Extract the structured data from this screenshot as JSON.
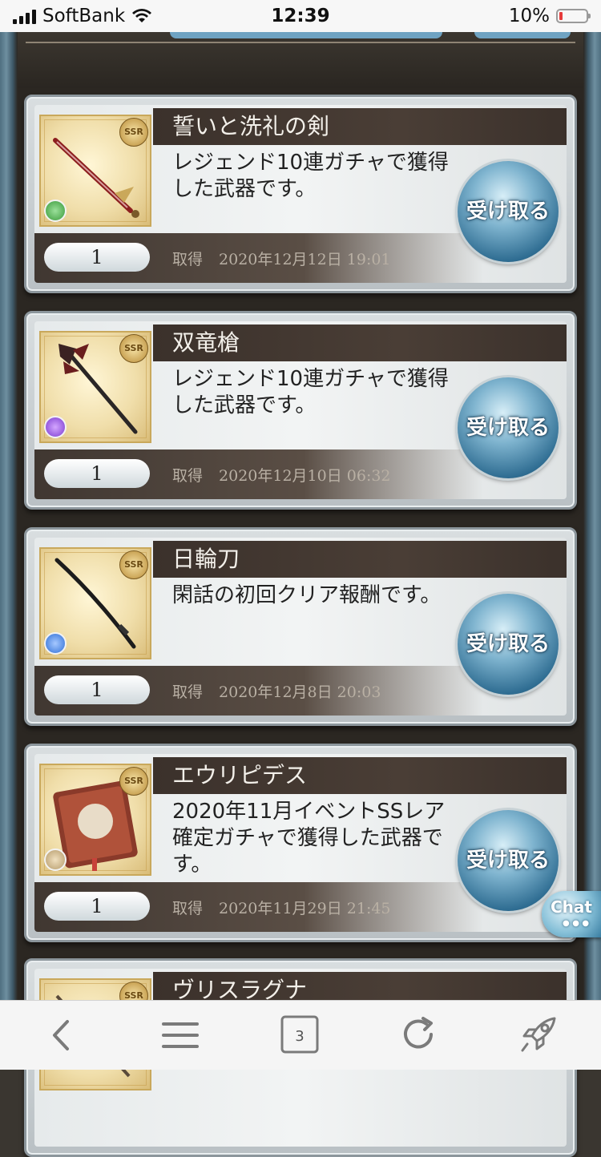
{
  "status_bar": {
    "carrier": "SoftBank",
    "time": "12:39",
    "battery": "10%"
  },
  "items": [
    {
      "name": "誓いと洗礼の剣",
      "description": "レジェンド10連ガチャで獲得した武器です。",
      "quantity": "1",
      "obtained_label": "取得",
      "obtained_date": "2020年12月12日 19:01",
      "rarity": "SSR",
      "element_color": "#3a9a3a",
      "icon": "sword-icon",
      "receive_label": "受け取る"
    },
    {
      "name": "双竜槍",
      "description": "レジェンド10連ガチャで獲得した武器です。",
      "quantity": "1",
      "obtained_label": "取得",
      "obtained_date": "2020年12月10日 06:32",
      "rarity": "SSR",
      "element_color": "#7a3ad0",
      "icon": "spear-icon",
      "receive_label": "受け取る"
    },
    {
      "name": "日輪刀",
      "description": "閑話の初回クリア報酬です。",
      "quantity": "1",
      "obtained_label": "取得",
      "obtained_date": "2020年12月8日 20:03",
      "rarity": "SSR",
      "element_color": "#2f6fd6",
      "icon": "katana-icon",
      "receive_label": "受け取る"
    },
    {
      "name": "エウリピデス",
      "description": "2020年11月イベントSSレア確定ガチャで獲得した武器です。",
      "quantity": "1",
      "obtained_label": "取得",
      "obtained_date": "2020年11月29日 21:45",
      "rarity": "SSR",
      "element_color": "#b59a6a",
      "icon": "book-icon",
      "receive_label": "受け取る"
    },
    {
      "name": "ヴリスラグナ",
      "rarity": "SSR",
      "icon": "weapon-icon"
    }
  ],
  "chat_label": "Chat",
  "toolbar": {
    "tabs_count": "3"
  },
  "colors": {
    "name_bar": "#3b312b",
    "frame": "#2b2722",
    "receive_button": "#2f6d92"
  }
}
